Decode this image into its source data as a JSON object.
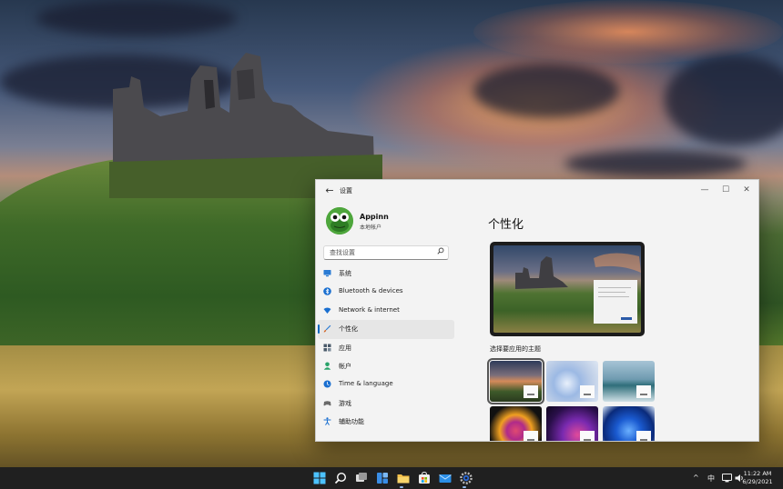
{
  "window": {
    "title": "设置",
    "back_glyph": "←",
    "controls": {
      "minimize": "—",
      "maximize": "☐",
      "close": "✕"
    }
  },
  "user": {
    "name": "Appinn",
    "account_type": "本地帐户"
  },
  "search": {
    "placeholder": "查找设置",
    "icon": "search-icon"
  },
  "nav": {
    "items": [
      {
        "label": "系统",
        "icon": "system-icon",
        "color": "#2a7bd4"
      },
      {
        "label": "Bluetooth & devices",
        "icon": "bluetooth-icon",
        "color": "#1a6fd0"
      },
      {
        "label": "Network & internet",
        "icon": "network-icon",
        "color": "#1a6fd0"
      },
      {
        "label": "个性化",
        "icon": "brush-icon",
        "color": "#d4682a",
        "active": true
      },
      {
        "label": "应用",
        "icon": "apps-icon",
        "color": "#4a5a6a"
      },
      {
        "label": "帐户",
        "icon": "account-icon",
        "color": "#2aa36a"
      },
      {
        "label": "Time & language",
        "icon": "globe-clock-icon",
        "color": "#1a6fd0"
      },
      {
        "label": "游戏",
        "icon": "gamepad-icon",
        "color": "#6a6a6a"
      },
      {
        "label": "辅助功能",
        "icon": "accessibility-icon",
        "color": "#1a6fd0"
      }
    ]
  },
  "content": {
    "title": "个性化",
    "themes_label": "选择要应用的主题",
    "themes": [
      {
        "name": "theme-sunset-castle",
        "selected": true
      },
      {
        "name": "theme-light-bloom"
      },
      {
        "name": "theme-lake"
      },
      {
        "name": "theme-captured-motion"
      },
      {
        "name": "theme-glow"
      },
      {
        "name": "theme-dark-bloom"
      }
    ]
  },
  "taskbar": {
    "icons": [
      "start-icon",
      "search-icon",
      "task-view-icon",
      "widgets-icon",
      "file-explorer-icon",
      "store-icon",
      "mail-icon",
      "settings-icon"
    ],
    "tray": {
      "chevron": "^",
      "ime": "中",
      "network": "network-icon",
      "volume": "volume-icon"
    },
    "time": "11:22 AM",
    "date": "6/29/2021"
  },
  "colors": {
    "accent": "#0067c0",
    "taskbar": "#202020",
    "window_bg": "#f3f3f3"
  }
}
